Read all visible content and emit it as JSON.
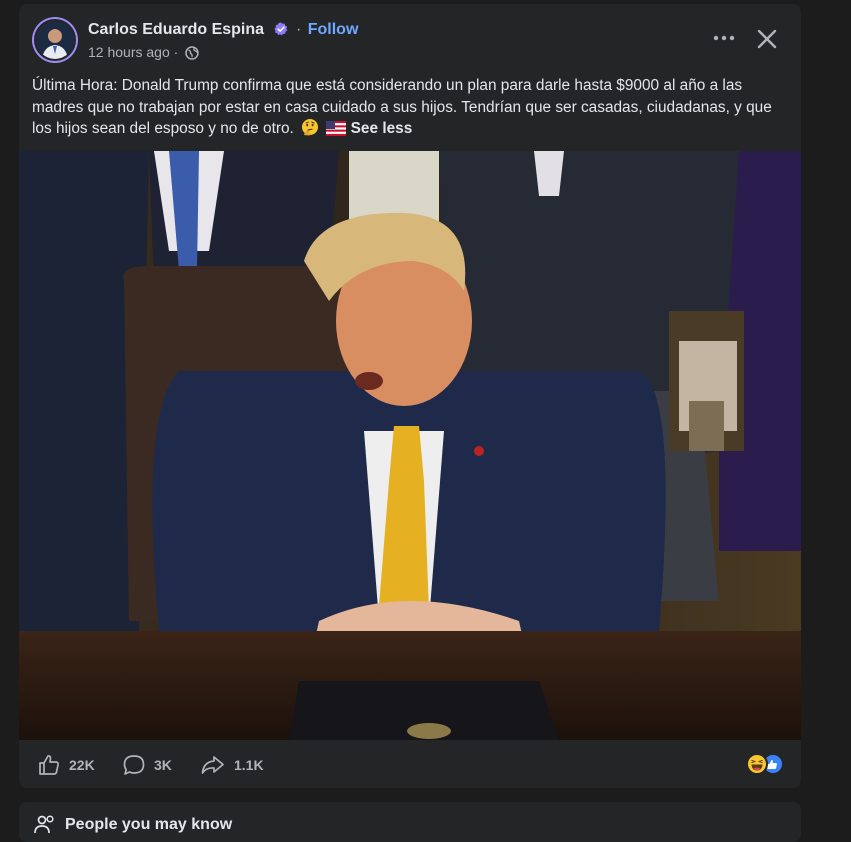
{
  "post": {
    "author": "Carlos Eduardo Espina",
    "separator": "·",
    "follow_label": "Follow",
    "time": "12 hours ago ·",
    "text": "Última Hora: Donald Trump confirma que está considerando un plan para darle hasta $9000 al año a las madres que no trabajan por estar en casa cuidado a sus hijos. Tendrían que ser casadas, ciudadanas, y que los hijos sean del esposo y no de otro.",
    "see_less_label": "See less",
    "emojis": [
      "thinking-face",
      "us-flag"
    ]
  },
  "stats": {
    "likes": "22K",
    "comments": "3K",
    "shares": "1.1K",
    "reactions": [
      "haha",
      "like"
    ]
  },
  "next_card": {
    "title": "People you may know"
  },
  "colors": {
    "background": "#1c1c1d",
    "card": "#242526",
    "text": "#e4e6eb",
    "secondary": "#b0b3b8",
    "accent": "#6fa8ff",
    "verified": "#8b7cf6"
  },
  "icons": {
    "more": "more-icon",
    "close": "close-icon",
    "like": "thumbs-up-icon",
    "comment": "comment-icon",
    "share": "share-icon",
    "privacy": "globe-icon"
  }
}
